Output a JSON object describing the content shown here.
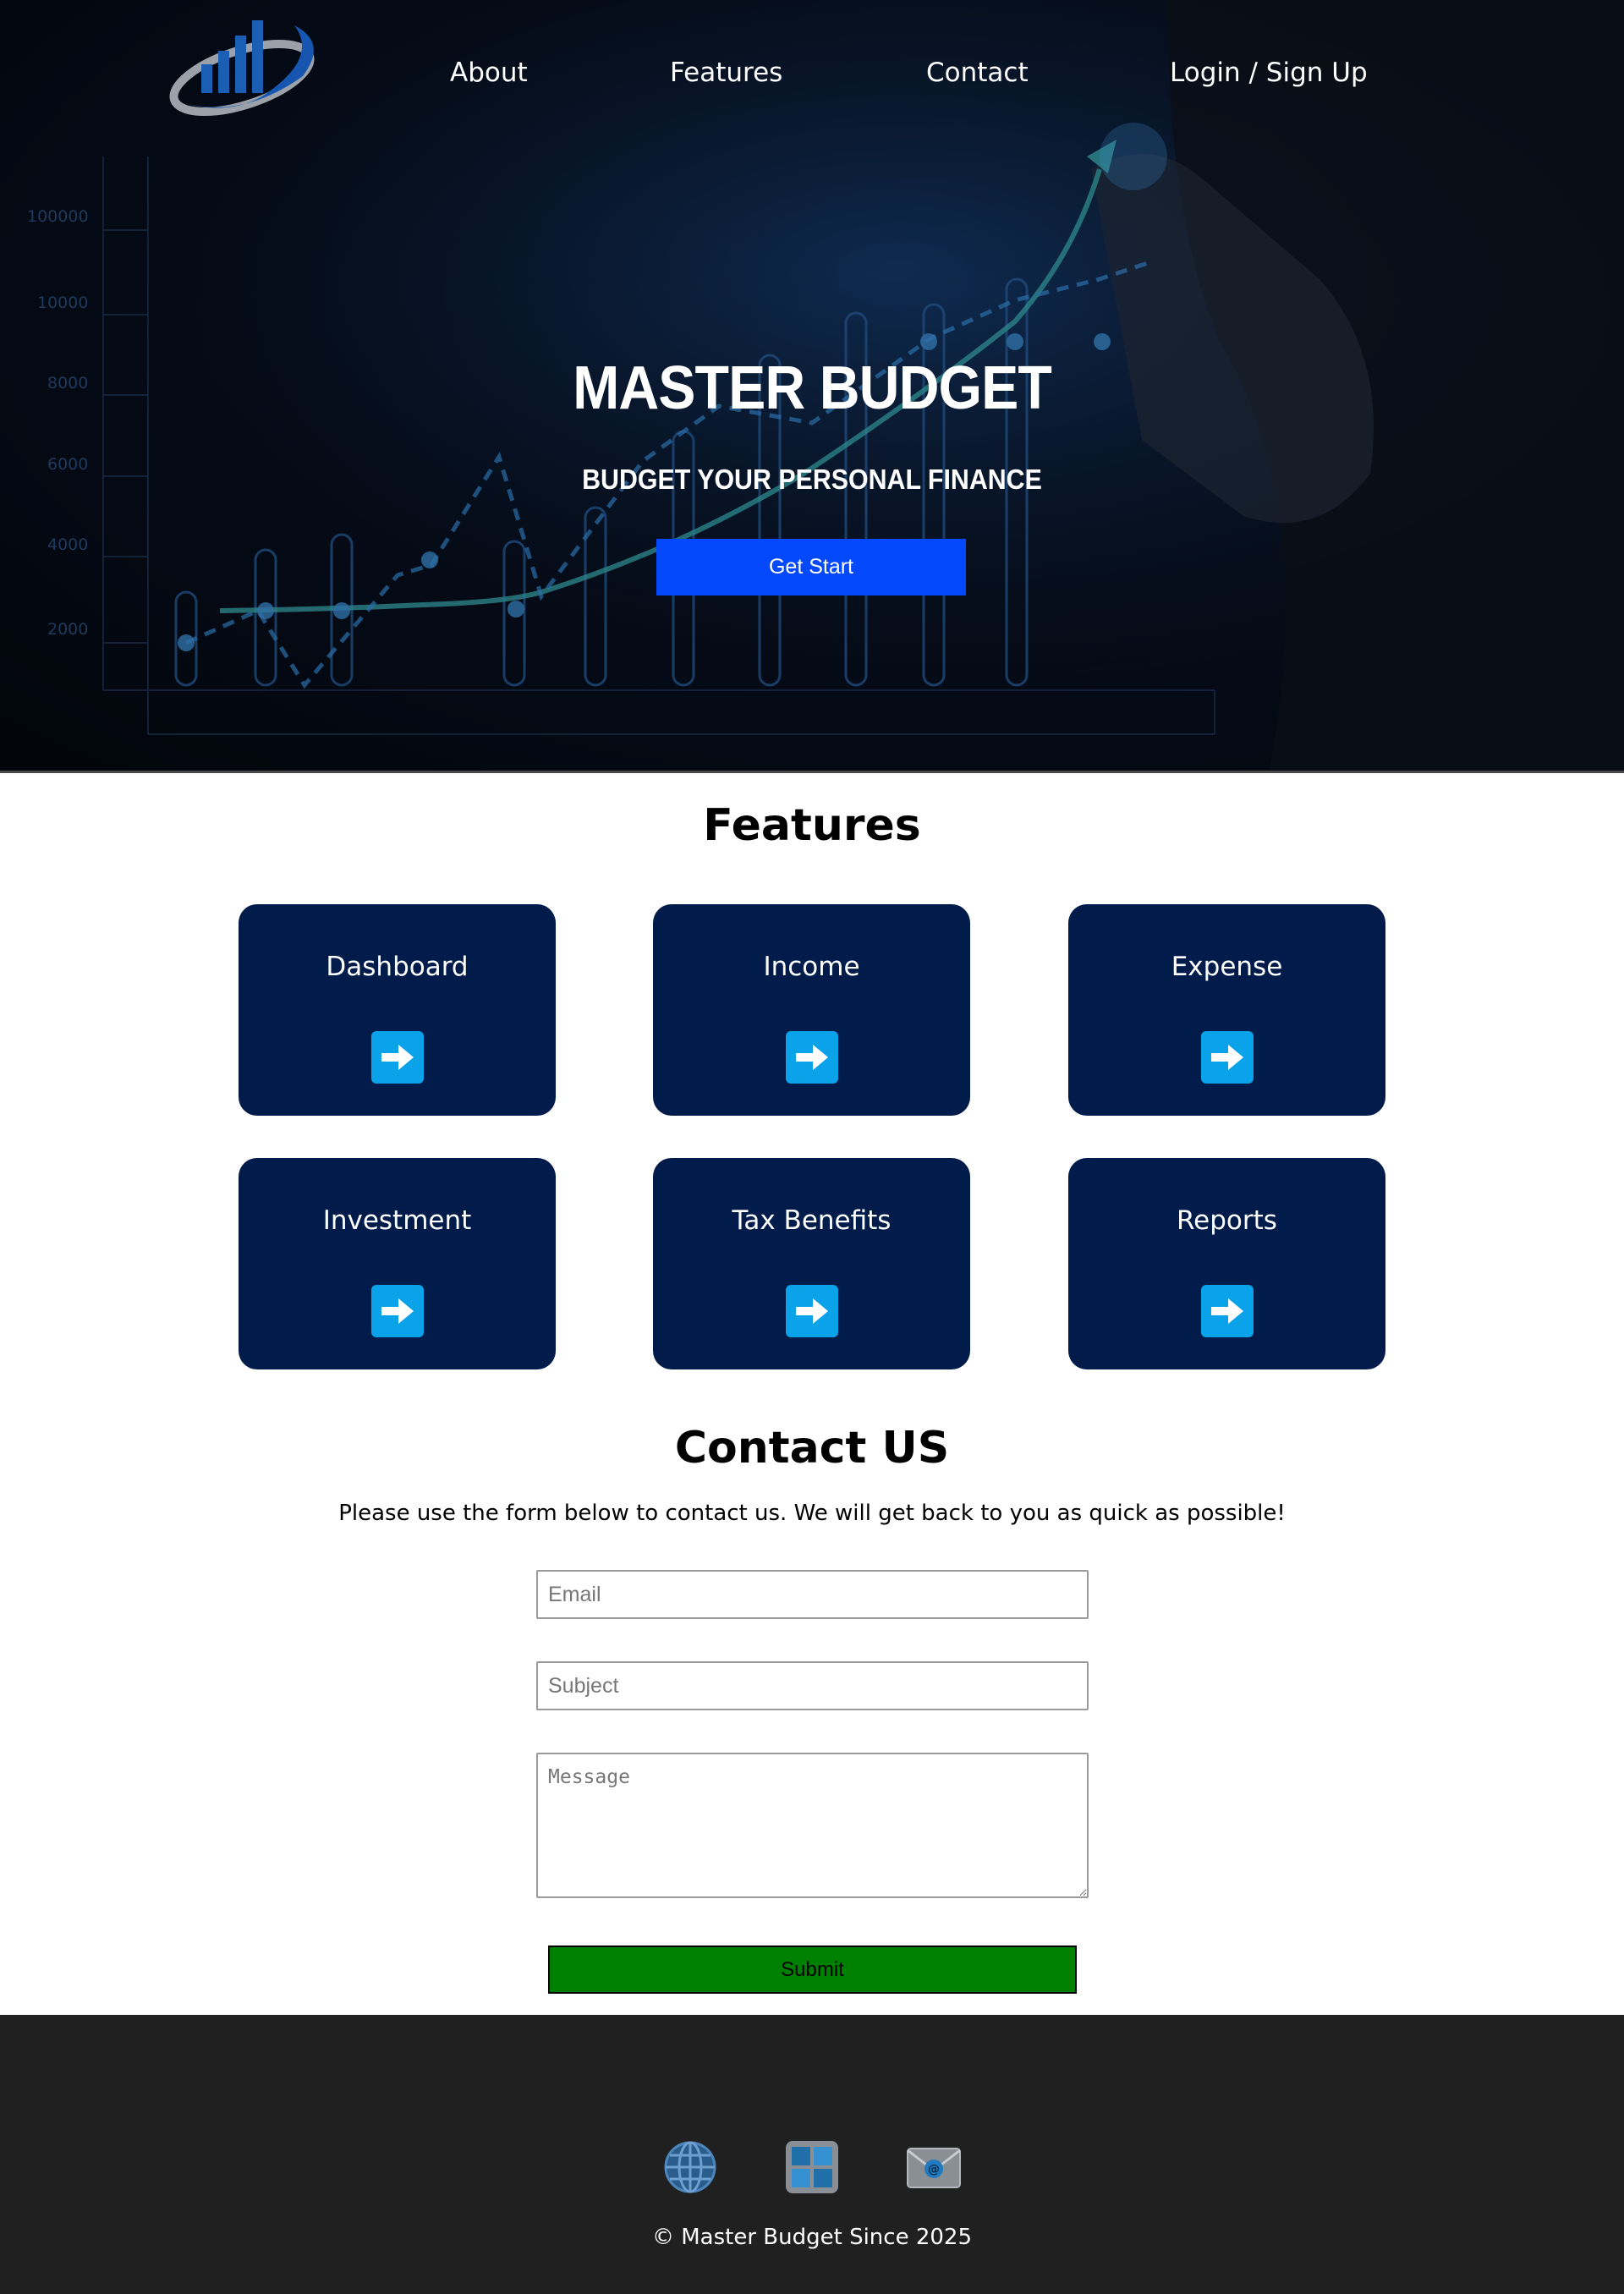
{
  "nav": {
    "items": [
      {
        "label": "About"
      },
      {
        "label": "Features"
      },
      {
        "label": "Contact"
      },
      {
        "label": "Login / Sign Up"
      }
    ]
  },
  "hero": {
    "title": "MASTER BUDGET",
    "subtitle": "BUDGET YOUR PERSONAL FINANCE",
    "cta_label": "Get Start",
    "bg_axis_labels": [
      "100000",
      "10000",
      "8000",
      "6000",
      "4000",
      "2000"
    ]
  },
  "features": {
    "title": "Features",
    "cards": [
      {
        "label": "Dashboard",
        "icon": "arrow-right-icon"
      },
      {
        "label": "Income",
        "icon": "arrow-right-icon"
      },
      {
        "label": "Expense",
        "icon": "arrow-right-icon"
      },
      {
        "label": "Investment",
        "icon": "arrow-right-icon"
      },
      {
        "label": "Tax Benefits",
        "icon": "arrow-right-icon"
      },
      {
        "label": "Reports",
        "icon": "arrow-right-icon"
      }
    ]
  },
  "contact": {
    "title": "Contact US",
    "description": "Please use the form below to contact us. We will get back to you as quick as possible!",
    "email_placeholder": "Email",
    "subject_placeholder": "Subject",
    "message_placeholder": "Message",
    "submit_label": "Submit"
  },
  "footer": {
    "icons": [
      "globe-icon",
      "windows-icon",
      "email-icon"
    ],
    "copyright": "© Master Budget Since 2025"
  },
  "colors": {
    "hero_bg": "#050b17",
    "cta_blue": "#0448fc",
    "card_navy": "#011c4a",
    "arrow_blue": "#0aa2e8",
    "submit_green": "#008000",
    "footer_bg": "#202020"
  }
}
